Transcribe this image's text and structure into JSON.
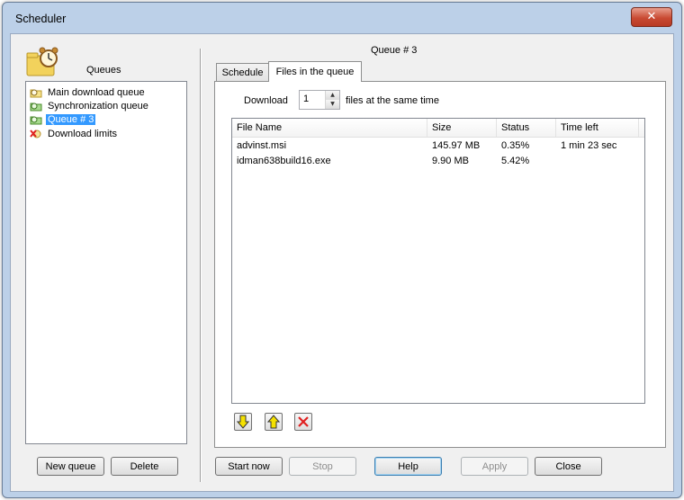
{
  "window": {
    "title": "Scheduler",
    "close_glyph": "✕"
  },
  "left_panel": {
    "header_label": "Queues",
    "header_icon": "alarm-clock-icon",
    "tree": [
      {
        "label": "Main download queue",
        "icon": "folder-clock-icon",
        "selected": false
      },
      {
        "label": "Synchronization queue",
        "icon": "sync-clock-icon",
        "selected": false
      },
      {
        "label": "Queue # 3",
        "icon": "queue-clock-icon",
        "selected": true
      },
      {
        "label": "Download limits",
        "icon": "limits-x-icon",
        "selected": false
      }
    ],
    "new_queue_label": "New queue",
    "delete_label": "Delete"
  },
  "right_panel": {
    "queue_title": "Queue # 3",
    "tabs": [
      {
        "label": "Schedule",
        "active": false
      },
      {
        "label": "Files in the queue",
        "active": true
      }
    ],
    "download_label": "Download",
    "concurrent_value": "1",
    "files_label": "files at the same time",
    "columns": [
      "File Name",
      "Size",
      "Status",
      "Time left"
    ],
    "files": [
      {
        "name": "advinst.msi",
        "size": "145.97  MB",
        "status": "0.35%",
        "time_left": "1 min 23 sec"
      },
      {
        "name": "idman638build16.exe",
        "size": "9.90  MB",
        "status": "5.42%",
        "time_left": ""
      }
    ],
    "list_buttons": [
      {
        "icon": "move-down-arrow-icon"
      },
      {
        "icon": "move-up-arrow-icon"
      },
      {
        "icon": "remove-x-icon"
      }
    ]
  },
  "footer_buttons": {
    "start_now": "Start now",
    "stop": "Stop",
    "help": "Help",
    "apply": "Apply",
    "close": "Close"
  },
  "colors": {
    "selection": "#3399ff",
    "close_button": "#c94a33",
    "arrow_yellow": "#f5e100",
    "remove_red": "#e02020"
  }
}
